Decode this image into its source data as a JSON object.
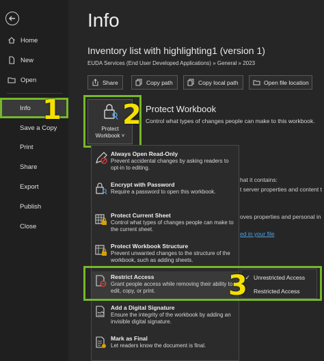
{
  "nav": {
    "back_icon": "back-arrow-icon",
    "items": [
      {
        "label": "Home",
        "icon": "home-icon"
      },
      {
        "label": "New",
        "icon": "new-doc-icon"
      },
      {
        "label": "Open",
        "icon": "folder-icon"
      },
      {
        "label": "Info",
        "active": true
      },
      {
        "label": "Save a Copy"
      },
      {
        "label": "Print"
      },
      {
        "label": "Share"
      },
      {
        "label": "Export"
      },
      {
        "label": "Publish"
      },
      {
        "label": "Close"
      }
    ]
  },
  "page": {
    "title": "Info",
    "doc_title": "Inventory list with highlighting1 (version 1)",
    "breadcrumb": "EUDA Services (End User Developed Applications) » General » 2023"
  },
  "toolbar": {
    "share": "Share",
    "copy_path": "Copy path",
    "copy_local_path": "Copy local path",
    "open_file_location": "Open file location"
  },
  "protect": {
    "tile_label_line1": "Protect",
    "tile_label_line2": "Workbook ˅",
    "title": "Protect Workbook",
    "description": "Control what types of changes people can make to this workbook."
  },
  "background_fragments": {
    "contains": "hat it contains:",
    "server": "t server properties and content t",
    "personal": "oves properties and personal in",
    "link": "ed in your file"
  },
  "menu": {
    "items": [
      {
        "title": "Always Open Read-Only",
        "desc": "Prevent accidental changes by asking readers to opt-in to editing.",
        "icon": "pencil-no-icon"
      },
      {
        "title": "Encrypt with Password",
        "desc": "Require a password to open this workbook.",
        "icon": "lock-key-icon"
      },
      {
        "title": "Protect Current Sheet",
        "desc": "Control what types of changes people can make to the current sheet.",
        "icon": "sheet-lock-icon"
      },
      {
        "title": "Protect Workbook Structure",
        "desc": "Prevent unwanted changes to the structure of the workbook, such as adding sheets.",
        "icon": "workbook-lock-icon"
      },
      {
        "title": "Restrict Access",
        "desc": "Grant people access while removing their ability to edit, copy, or print.",
        "icon": "restrict-doc-icon"
      },
      {
        "title": "Add a Digital Signature",
        "desc": "Ensure the integrity of the workbook by adding an invisible digital signature.",
        "icon": "signature-icon"
      },
      {
        "title": "Mark as Final",
        "desc": "Let readers know the document is final.",
        "icon": "final-doc-icon"
      }
    ]
  },
  "submenu": {
    "items": [
      {
        "label": "Unrestricted Access",
        "checked": true
      },
      {
        "label": "Restricted Access",
        "checked": false
      }
    ],
    "check_glyph": "✓"
  },
  "callouts": {
    "one": "1",
    "two": "2",
    "three": "3"
  },
  "colors": {
    "highlight": "#76b82a",
    "callout_number": "#f5e000",
    "link": "#4ea3e6"
  }
}
